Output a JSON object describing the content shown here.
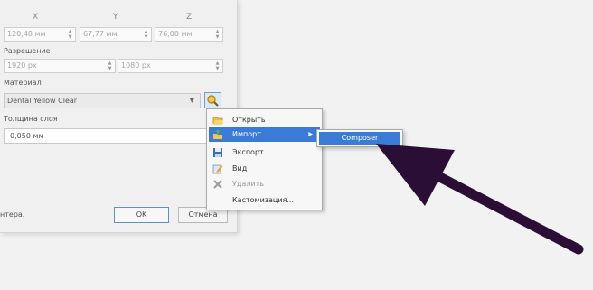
{
  "coords": {
    "x_label": "X",
    "y_label": "Y",
    "z_label": "Z",
    "x_value": "120,48 мм",
    "y_value": "67,77 мм",
    "z_value": "76,00 мм"
  },
  "resolution": {
    "label": "Разрешение",
    "width_value": "1920 px",
    "height_value": "1080 px"
  },
  "material": {
    "label": "Материал",
    "selected": "Dental Yellow Clear"
  },
  "layer": {
    "label": "Толщина слоя",
    "value": "0,050 мм"
  },
  "footer": {
    "left_text": "нтера.",
    "ok_label": "OK",
    "cancel_label": "Отмена"
  },
  "context_menu": {
    "items": [
      {
        "label": "Открыть",
        "icon": "folder-open-icon",
        "state": "normal"
      },
      {
        "label": "Импорт",
        "icon": "import-icon",
        "state": "active"
      },
      {
        "label": "Экспорт",
        "icon": "save-icon",
        "state": "normal"
      },
      {
        "label": "Вид",
        "icon": "edit-icon",
        "state": "normal"
      },
      {
        "label": "Удалить",
        "icon": "delete-icon",
        "state": "disabled"
      },
      {
        "label": "Кастомизация...",
        "icon": "none",
        "state": "normal"
      }
    ],
    "submenu_arrow": "▶",
    "submenu": {
      "label": "Composer"
    }
  },
  "annotation": {
    "type": "arrow",
    "color": "#2a0e35"
  },
  "colors": {
    "accent": "#3b7bd8",
    "background": "#f2f2f2"
  }
}
